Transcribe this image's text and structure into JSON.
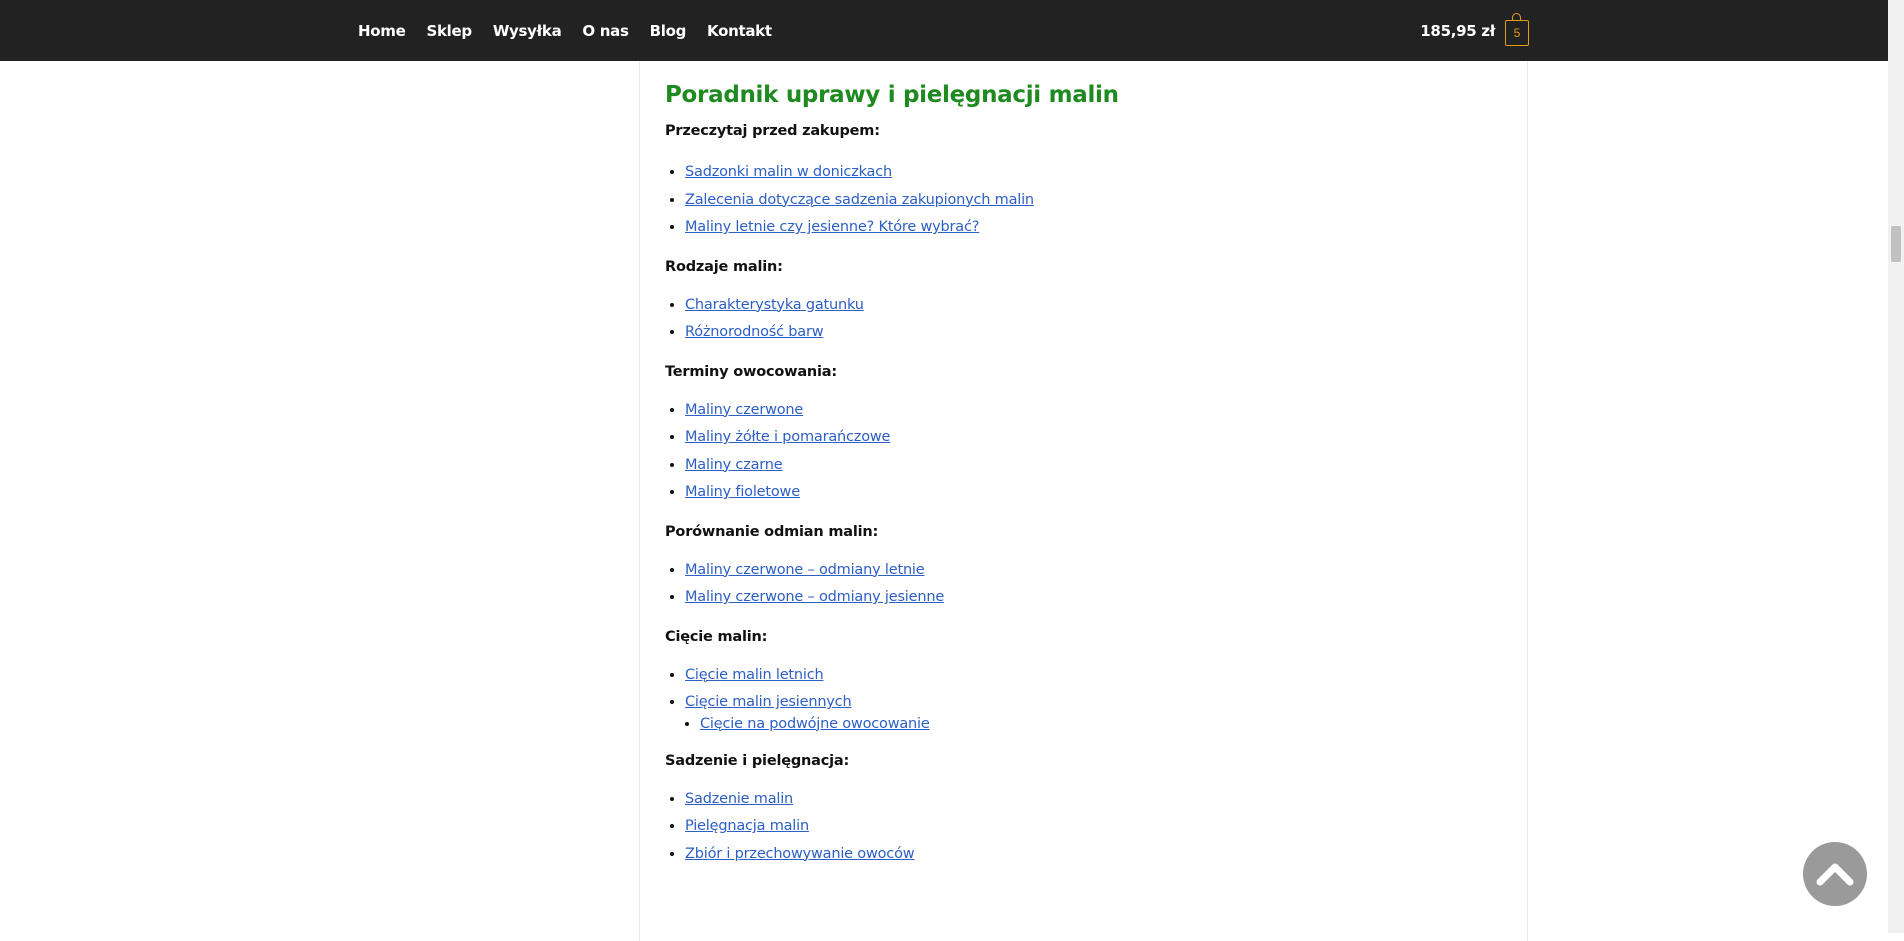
{
  "nav": {
    "items": [
      "Home",
      "Sklep",
      "Wysyłka",
      "O nas",
      "Blog",
      "Kontakt"
    ]
  },
  "cart": {
    "amount": "185,95 zł",
    "count": "5",
    "icon": "shopping-bag-icon"
  },
  "guide": {
    "title": "Poradnik uprawy i pielęgnacji malin",
    "sections": [
      {
        "heading": "Przeczytaj przed zakupem:",
        "links": [
          "Sadzonki malin w doniczkach",
          "Zalecenia dotyczące sadzenia zakupionych malin",
          "Maliny letnie czy jesienne? Które wybrać?"
        ]
      },
      {
        "heading": "Rodzaje malin:",
        "links": [
          "Charakterystyka gatunku",
          "Różnorodność barw"
        ]
      },
      {
        "heading": "Terminy owocowania:",
        "links": [
          "Maliny czerwone",
          "Maliny żółte i pomarańczowe",
          "Maliny czarne",
          "Maliny fioletowe"
        ]
      },
      {
        "heading": "Porównanie odmian malin:",
        "links": [
          "Maliny czerwone – odmiany letnie",
          "Maliny czerwone – odmiany jesienne"
        ]
      },
      {
        "heading": "Cięcie malin:",
        "links": [
          "Cięcie malin letnich",
          "Cięcie malin jesiennych"
        ],
        "sublinks": [
          "Cięcie na podwójne owocowanie"
        ]
      },
      {
        "heading": "Sadzenie i pielęgnacja:",
        "links": [
          "Sadzenie malin",
          "Pielęgnacja malin",
          "Zbiór i przechowywanie owoców"
        ]
      }
    ]
  },
  "back_to_top": {
    "icon": "chevron-up-icon"
  },
  "colors": {
    "topbar": "#222222",
    "title_green": "#1f8a1f",
    "link_blue": "#2d5fc4",
    "cart_accent": "#e69a18"
  }
}
